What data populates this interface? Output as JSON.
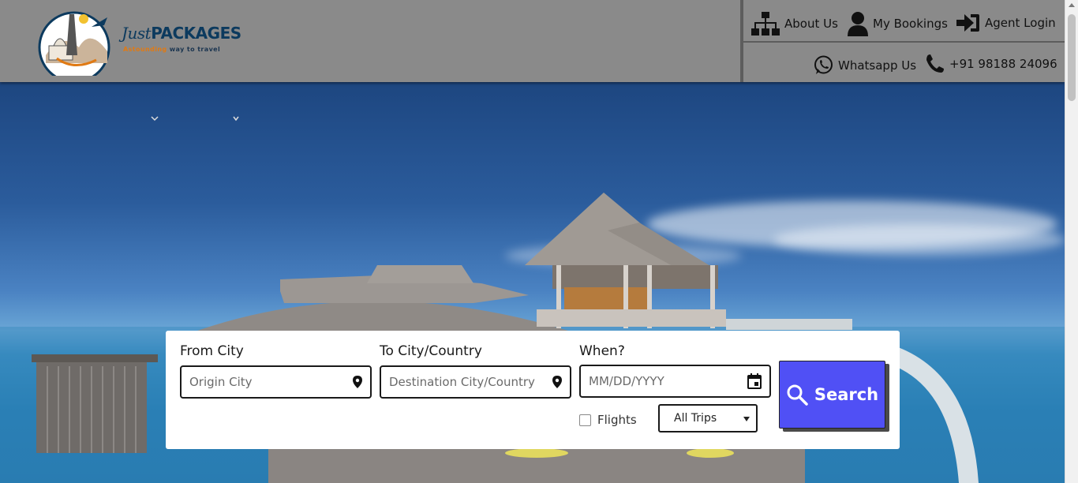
{
  "brand": {
    "name_script": "Just",
    "name_bold": "PACKAGES",
    "tagline_highlight": "Astounding",
    "tagline_rest": "way to travel",
    "colors": {
      "navy": "#0c3a5e",
      "orange": "#e07a14"
    }
  },
  "nav": {
    "about": "About Us",
    "bookings": "My Bookings",
    "agent_login": "Agent Login",
    "whatsapp": "Whatsapp Us",
    "phone": "+91 98188 24096"
  },
  "search": {
    "from_label": "From City",
    "from_placeholder": "Origin City",
    "to_label": "To City/Country",
    "to_placeholder": "Destination City/Country",
    "when_label": "When?",
    "when_placeholder": "MM/DD/YYYY",
    "flights_label": "Flights",
    "flights_checked": false,
    "trip_select_value": "All Trips",
    "button_label": "Search",
    "button_color": "#5050f5"
  },
  "icons": {
    "about": "sitemap-icon",
    "bookings": "user-icon",
    "agent_login": "sign-in-icon",
    "whatsapp": "whatsapp-icon",
    "phone": "phone-icon",
    "from_field": "map-pin-icon",
    "to_field": "map-pin-icon",
    "date_field": "calendar-icon",
    "search_button": "search-icon"
  }
}
